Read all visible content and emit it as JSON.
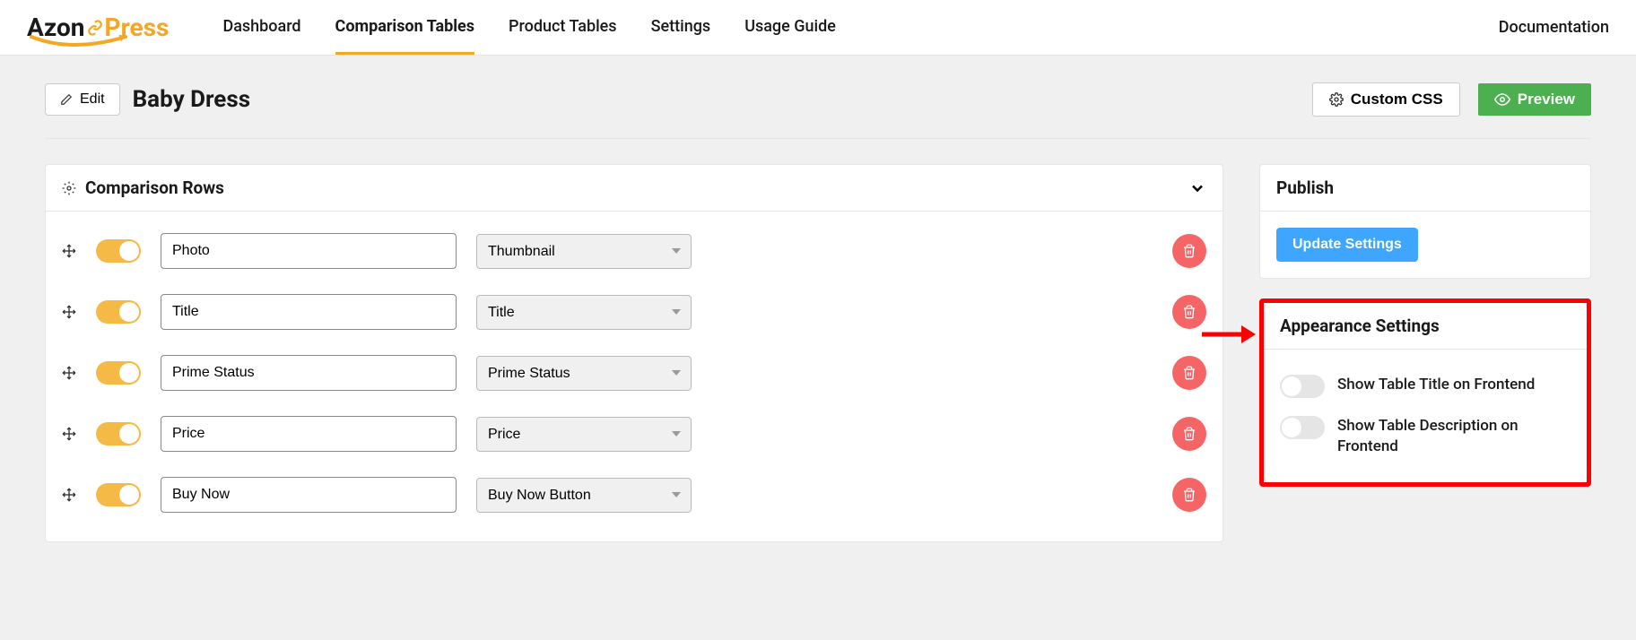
{
  "logo": {
    "part1": "Azon",
    "part2": "Press"
  },
  "nav": {
    "items": [
      "Dashboard",
      "Comparison Tables",
      "Product Tables",
      "Settings",
      "Usage Guide"
    ],
    "active_index": 1
  },
  "doc_link": "Documentation",
  "edit_button": "Edit",
  "page_title": "Baby Dress",
  "custom_css_button": "Custom CSS",
  "preview_button": "Preview",
  "comparison_rows": {
    "title": "Comparison Rows",
    "rows": [
      {
        "label": "Photo",
        "type": "Thumbnail"
      },
      {
        "label": "Title",
        "type": "Title"
      },
      {
        "label": "Prime Status",
        "type": "Prime Status"
      },
      {
        "label": "Price",
        "type": "Price"
      },
      {
        "label": "Buy Now",
        "type": "Buy Now Button"
      }
    ]
  },
  "publish": {
    "title": "Publish",
    "button": "Update Settings"
  },
  "appearance": {
    "title": "Appearance Settings",
    "options": [
      "Show Table Title on Frontend",
      "Show Table Description on Frontend"
    ]
  }
}
